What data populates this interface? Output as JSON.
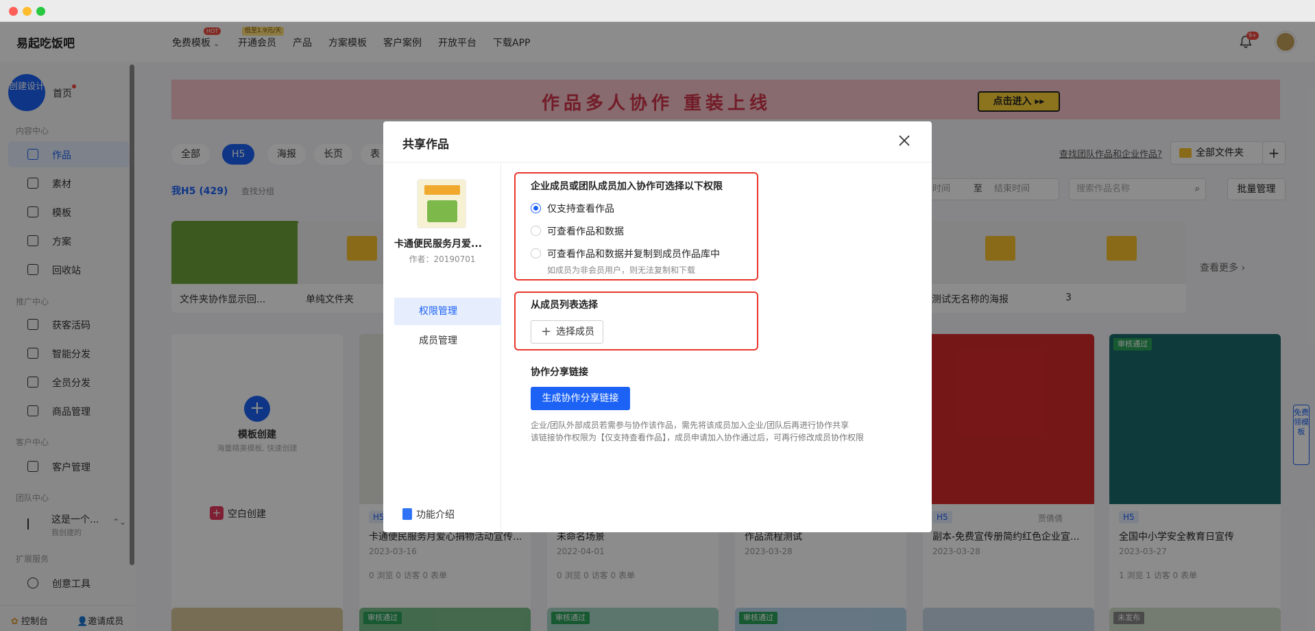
{
  "app": {
    "brand": "易起吃饭吧"
  },
  "topnav": {
    "items": [
      "免费模板",
      "开通会员",
      "产品",
      "方案模板",
      "客户案例",
      "开放平台",
      "下载APP"
    ],
    "hot_badge": "HOT",
    "promo_badge": "低至1.9元/天",
    "bell_badge": "9+"
  },
  "sidebar": {
    "create": "创建设计",
    "home": "首页",
    "sections": {
      "content": "内容中心",
      "promo": "推广中心",
      "customer": "客户中心",
      "team": "团队中心",
      "ext": "扩展服务"
    },
    "items": [
      "作品",
      "素材",
      "模板",
      "方案",
      "回收站",
      "获客活码",
      "智能分发",
      "全员分发",
      "商品管理",
      "客户管理",
      "创意工具"
    ],
    "team_name": "这是一个...",
    "team_sub": "我创建的",
    "bottom": {
      "console": "控制台",
      "invite": "邀请成员"
    }
  },
  "main": {
    "banner_text": "作品多人协作 重装上线",
    "banner_btn": "点击进入 ▸▸",
    "tabs": [
      "全部",
      "H5",
      "海报",
      "长页",
      "表"
    ],
    "find_link": "查找团队作品和企业作品?",
    "folder_btn": "全部文件夹",
    "my_h5": "我H5 (429)",
    "find_group": "查找分组",
    "date_from": "时间",
    "date_to": "结束时间",
    "date_sep": "至",
    "search_placeholder": "搜索作品名称",
    "batch": "批量管理",
    "folders": [
      "文件夹协作显示回...",
      "单纯文件夹",
      "测试无名称的海报",
      "3"
    ],
    "see_more": "查看更多 ›",
    "create_card": {
      "title": "模板创建",
      "sub": "海量精美模板, 快速创建",
      "blank": "空白创建"
    },
    "works": [
      {
        "badge": "H5",
        "title": "卡通便民服务月爱心捐物活动宣传...",
        "date": "2023-03-16",
        "stats": "0 浏览   0 访客   0 表单"
      },
      {
        "badge": "",
        "title": "未命名场景",
        "date": "2022-04-01",
        "stats": "0 浏览   0 访客   0 表单"
      },
      {
        "badge": "",
        "title": "作品流程测试",
        "date": "2023-03-28",
        "stats": ""
      },
      {
        "badge": "H5",
        "title": "副本-免费宣传册简约红色企业宣...",
        "date": "2023-03-28",
        "stats": "",
        "owner": "贾倩倩"
      },
      {
        "badge": "H5",
        "title": "全国中小学安全教育日宣传",
        "date": "2023-03-27",
        "stats": "1 浏览   1 访客   0 表单",
        "audit": "审核通过"
      }
    ],
    "bottom_badges": [
      "审核通过",
      "审核通过",
      "审核通过",
      "未发布"
    ],
    "float_side": "免费领模板"
  },
  "modal": {
    "title": "共享作品",
    "work_name": "卡通便民服务月爱...",
    "work_author": "作者：20190701",
    "menu": [
      "权限管理",
      "成员管理"
    ],
    "intro": "功能介绍",
    "perm_title": "企业成员或团队成员加入协作可选择以下权限",
    "options": [
      "仅支持查看作品",
      "可查看作品和数据",
      "可查看作品和数据并复制到成员作品库中"
    ],
    "option_hint": "如成员为非会员用户，则无法复制和下载",
    "member_title": "从成员列表选择",
    "select_btn": "选择成员",
    "link_title": "协作分享链接",
    "gen_btn": "生成协作分享链接",
    "note1": "企业/团队外部成员若需参与协作该作品，需先将该成员加入企业/团队后再进行协作共享",
    "note2": "该链接协作权限为【仅支持查看作品】，成员申请加入协作通过后，可再行修改成员协作权限"
  }
}
